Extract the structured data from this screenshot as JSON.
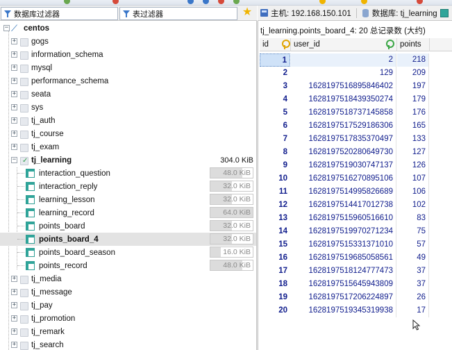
{
  "toolbar": {
    "db_filter_placeholder": "数据库过滤器",
    "table_filter_placeholder": "表过滤器"
  },
  "header": {
    "host_label": "主机: 192.168.150.101",
    "db_label": "数据库: tj_learning"
  },
  "tree": {
    "root": "centos",
    "databases": [
      "gogs",
      "information_schema",
      "mysql",
      "performance_schema",
      "seata",
      "sys",
      "tj_auth",
      "tj_course",
      "tj_exam"
    ],
    "open_db": {
      "name": "tj_learning",
      "size": "304.0 KiB"
    },
    "tables": [
      {
        "name": "interaction_question",
        "size": "48.0 KiB",
        "fill": 0.75
      },
      {
        "name": "interaction_reply",
        "size": "32.0 KiB",
        "fill": 0.5
      },
      {
        "name": "learning_lesson",
        "size": "32.0 KiB",
        "fill": 0.5
      },
      {
        "name": "learning_record",
        "size": "64.0 KiB",
        "fill": 1.0
      },
      {
        "name": "points_board",
        "size": "32.0 KiB",
        "fill": 0.5
      },
      {
        "name": "points_board_4",
        "size": "32.0 KiB",
        "fill": 0.5,
        "selected": true
      },
      {
        "name": "points_board_season",
        "size": "16.0 KiB",
        "fill": 0.25
      },
      {
        "name": "points_record",
        "size": "48.0 KiB",
        "fill": 0.75
      }
    ],
    "more_databases": [
      "tj_media",
      "tj_message",
      "tj_pay",
      "tj_promotion",
      "tj_remark",
      "tj_search"
    ]
  },
  "grid": {
    "title": "tj_learning.points_board_4: 20 总记录数 (大约)",
    "columns": {
      "id": "id",
      "user_id": "user_id",
      "points": "points"
    },
    "rows": [
      {
        "id": "1",
        "user_id": "2",
        "points": "218"
      },
      {
        "id": "2",
        "user_id": "129",
        "points": "209"
      },
      {
        "id": "3",
        "user_id": "1628197516895846402",
        "points": "197"
      },
      {
        "id": "4",
        "user_id": "1628197518439350274",
        "points": "179"
      },
      {
        "id": "5",
        "user_id": "1628197518737145858",
        "points": "176"
      },
      {
        "id": "6",
        "user_id": "1628197517529186306",
        "points": "165"
      },
      {
        "id": "7",
        "user_id": "1628197517835370497",
        "points": "133"
      },
      {
        "id": "8",
        "user_id": "1628197520280649730",
        "points": "127"
      },
      {
        "id": "9",
        "user_id": "1628197519030747137",
        "points": "126"
      },
      {
        "id": "10",
        "user_id": "1628197516270895106",
        "points": "107"
      },
      {
        "id": "11",
        "user_id": "1628197514995826689",
        "points": "106"
      },
      {
        "id": "12",
        "user_id": "1628197514417012738",
        "points": "102"
      },
      {
        "id": "13",
        "user_id": "1628197515960516610",
        "points": "83"
      },
      {
        "id": "14",
        "user_id": "1628197519970271234",
        "points": "75"
      },
      {
        "id": "15",
        "user_id": "1628197515331371010",
        "points": "57"
      },
      {
        "id": "16",
        "user_id": "1628197519685058561",
        "points": "49"
      },
      {
        "id": "17",
        "user_id": "1628197518124777473",
        "points": "37"
      },
      {
        "id": "18",
        "user_id": "1628197515645943809",
        "points": "37"
      },
      {
        "id": "19",
        "user_id": "1628197517206224897",
        "points": "26"
      },
      {
        "id": "20",
        "user_id": "1628197519345319938",
        "points": "17"
      }
    ]
  },
  "colors": {
    "accent": "#0f1c8c",
    "table_icon": "#2fa59a",
    "selection": "#cfe2f8"
  }
}
